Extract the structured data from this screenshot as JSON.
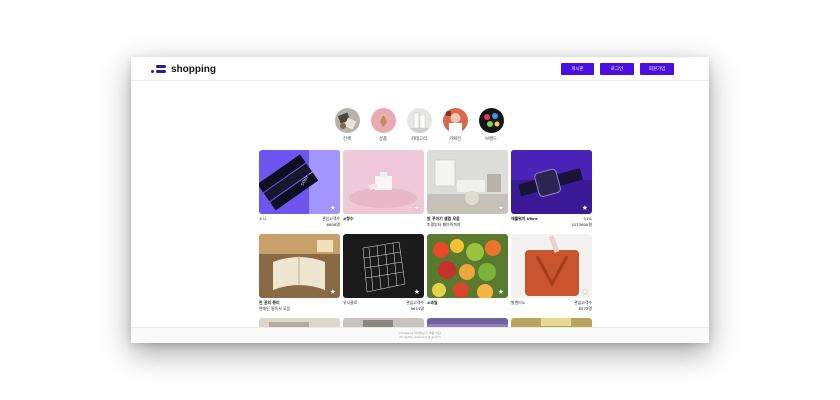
{
  "header": {
    "logo_text": "shopping"
  },
  "nav": {
    "write_label": "게시판",
    "login_label": "로그인",
    "signup_label": "회원가입"
  },
  "categories": [
    {
      "label": "전체"
    },
    {
      "label": "상품"
    },
    {
      "label": "카테고리"
    },
    {
      "label": "기획전"
    },
    {
      "label": "브랜드"
    }
  ],
  "products": [
    {
      "name": "소니",
      "meta": "관심고객수",
      "sub": "6808명"
    },
    {
      "name": "#향수",
      "meta": "",
      "sub": ""
    },
    {
      "name": "방 꾸미기 셀럽 모음",
      "meta": "",
      "sub": "조명부터 패브릭까지"
    },
    {
      "name": "애플워치 Ultra",
      "meta": "51%",
      "sub": "1073600원"
    },
    {
      "name": "한 권의 풍미",
      "meta": "",
      "sub": "현대인 필독서 모음"
    },
    {
      "name": "유니클로",
      "meta": "관심고객수",
      "sub": "9614명"
    },
    {
      "name": "#과일",
      "meta": "",
      "sub": ""
    },
    {
      "name": "발렌티노",
      "meta": "관심고객수",
      "sub": "8572명"
    }
  ],
  "footer": {
    "line1": "shopping 자세히보기 이용 약관",
    "line2": "All rights reserved @ sumin"
  },
  "colors": {
    "accent": "#4a0ee0",
    "logo": "#2b1c8f"
  },
  "icons": {
    "favorite": "star-icon"
  }
}
